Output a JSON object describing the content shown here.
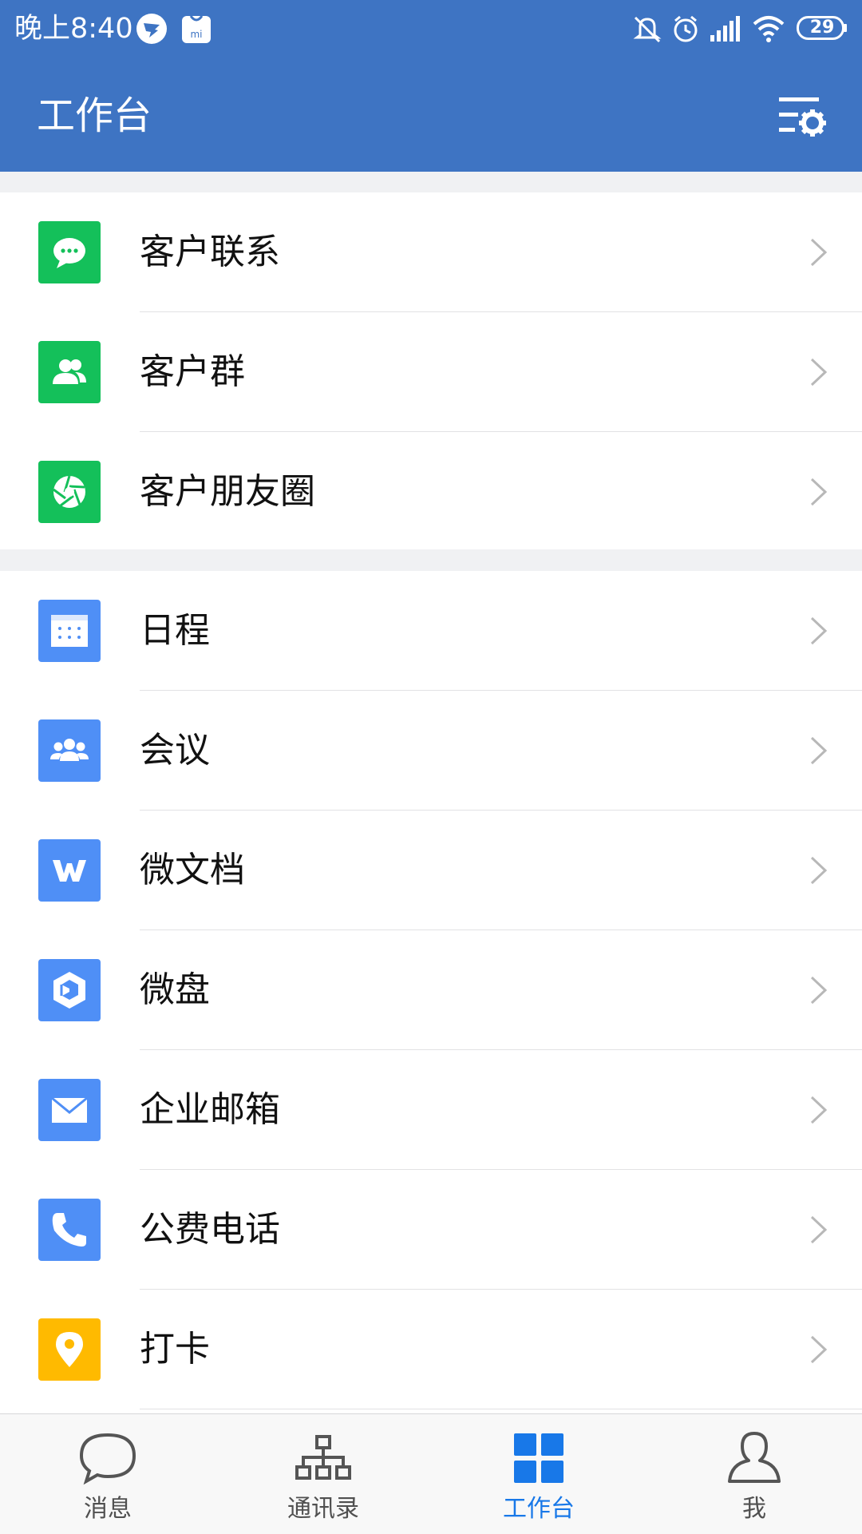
{
  "status_bar": {
    "time": "晚上8:40",
    "battery": "29"
  },
  "header": {
    "title": "工作台"
  },
  "sections": [
    {
      "items": [
        {
          "label": "客户联系",
          "icon": "chat-bubble-icon",
          "color": "#14c05a"
        },
        {
          "label": "客户群",
          "icon": "group-icon",
          "color": "#14c05a"
        },
        {
          "label": "客户朋友圈",
          "icon": "aperture-icon",
          "color": "#14c05a"
        }
      ]
    },
    {
      "items": [
        {
          "label": "日程",
          "icon": "calendar-icon",
          "color": "#4f8ff6"
        },
        {
          "label": "会议",
          "icon": "meeting-icon",
          "color": "#4f8ff6"
        },
        {
          "label": "微文档",
          "icon": "document-w-icon",
          "color": "#4f8ff6"
        },
        {
          "label": "微盘",
          "icon": "drive-icon",
          "color": "#4f8ff6"
        },
        {
          "label": "企业邮箱",
          "icon": "mail-icon",
          "color": "#4f8ff6"
        },
        {
          "label": "公费电话",
          "icon": "phone-icon",
          "color": "#4f8ff6"
        },
        {
          "label": "打卡",
          "icon": "location-pin-icon",
          "color": "#ffba00"
        }
      ]
    }
  ],
  "bottom_nav": {
    "tabs": [
      {
        "label": "消息",
        "icon": "message-icon",
        "active": false
      },
      {
        "label": "通讯录",
        "icon": "contacts-org-icon",
        "active": false
      },
      {
        "label": "工作台",
        "icon": "workbench-grid-icon",
        "active": true
      },
      {
        "label": "我",
        "icon": "profile-icon",
        "active": false
      }
    ]
  },
  "colors": {
    "header_bg": "#3e74c3",
    "green": "#14c05a",
    "blue": "#4f8ff6",
    "yellow": "#ffba00",
    "active_tab": "#1878e8"
  }
}
